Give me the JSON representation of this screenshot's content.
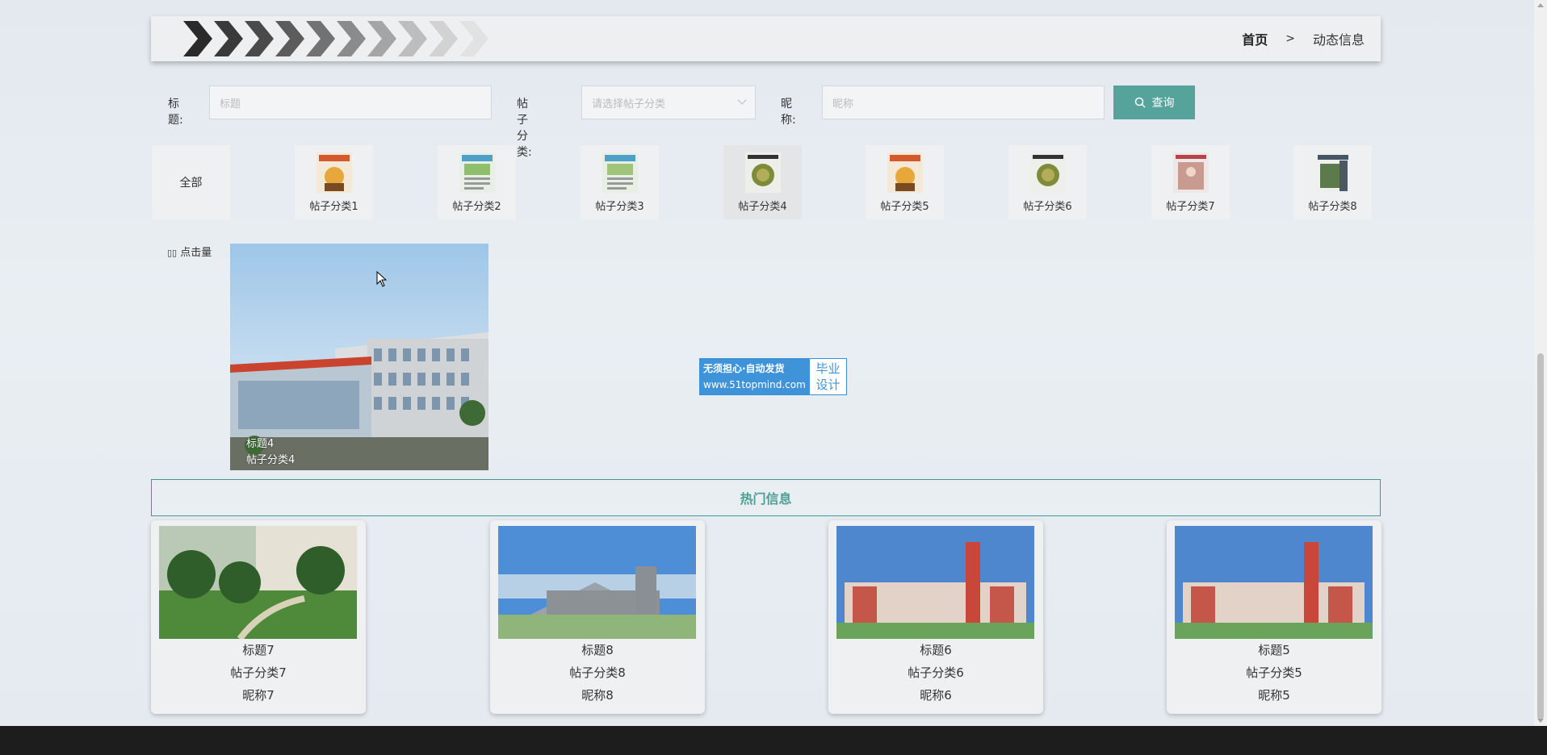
{
  "breadcrumb": {
    "home": "首页",
    "separator": ">",
    "current": "动态信息"
  },
  "search": {
    "title_label": "标题:",
    "title_placeholder": "标题",
    "category_label": "帖子分类:",
    "category_placeholder": "请选择帖子分类",
    "nickname_label": "昵称:",
    "nickname_placeholder": "昵称",
    "button_label": "查询"
  },
  "categories": [
    {
      "label": "全部"
    },
    {
      "label": "帖子分类1"
    },
    {
      "label": "帖子分类2"
    },
    {
      "label": "帖子分类3"
    },
    {
      "label": "帖子分类4"
    },
    {
      "label": "帖子分类5"
    },
    {
      "label": "帖子分类6"
    },
    {
      "label": "帖子分类7"
    },
    {
      "label": "帖子分类8"
    }
  ],
  "sort": {
    "label": "点击量"
  },
  "posts": [
    {
      "title": "标题4",
      "category": "帖子分类4"
    }
  ],
  "watermark": {
    "line1": "无须担心·自动发货",
    "url": "www.51topmind.com",
    "right": "毕业设计"
  },
  "hot": {
    "title": "热门信息",
    "items": [
      {
        "title": "标题7",
        "category": "帖子分类7",
        "nickname": "昵称7"
      },
      {
        "title": "标题8",
        "category": "帖子分类8",
        "nickname": "昵称8"
      },
      {
        "title": "标题6",
        "category": "帖子分类6",
        "nickname": "昵称6"
      },
      {
        "title": "标题5",
        "category": "帖子分类5",
        "nickname": "昵称5"
      }
    ]
  },
  "colors": {
    "accent": "#56a39b",
    "hot_border": "#3e9a90",
    "watermark_blue": "#3f94d9"
  }
}
